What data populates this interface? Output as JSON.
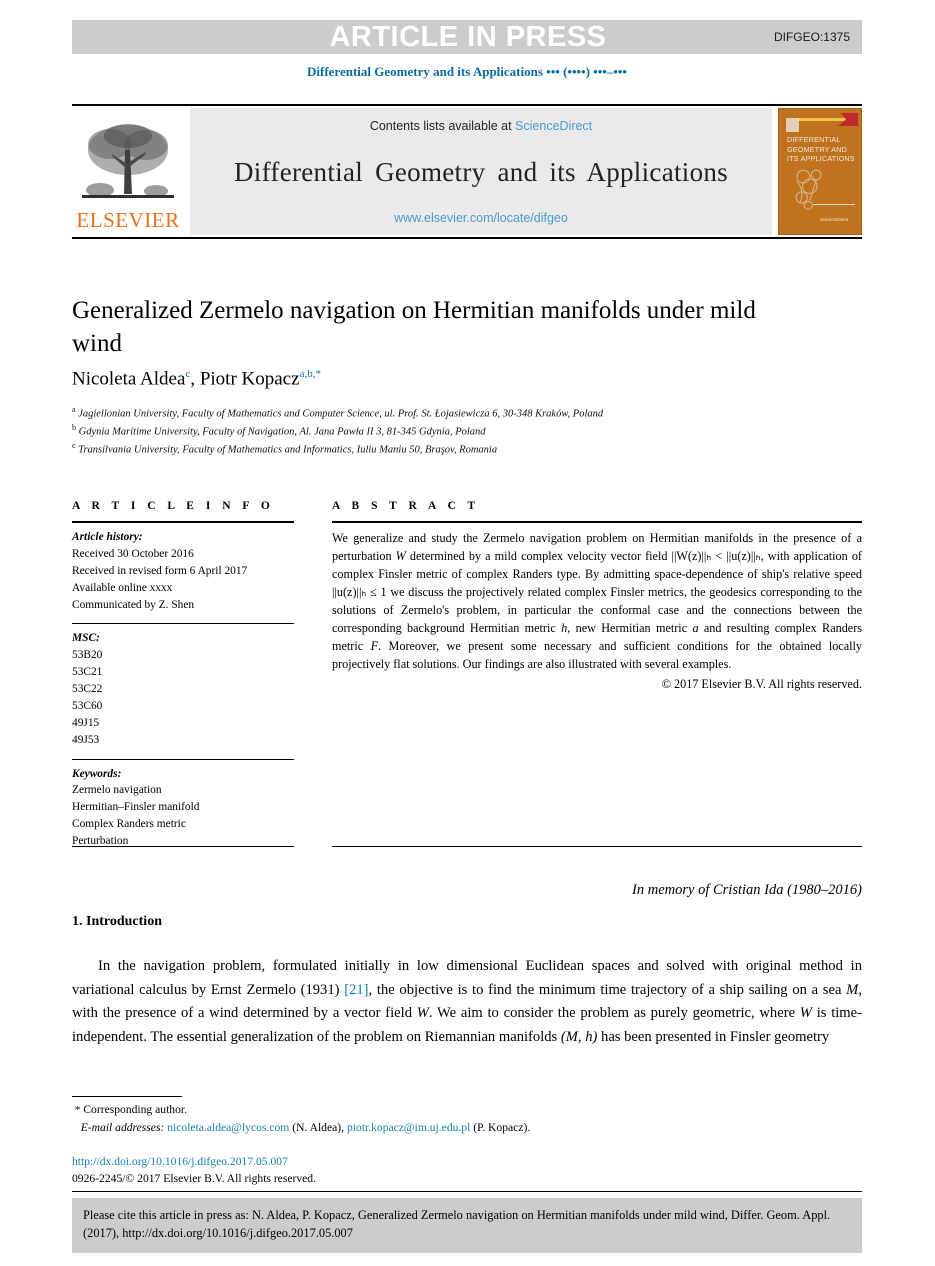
{
  "banner": {
    "press_text": "ARTICLE IN PRESS",
    "code": "DIFGEO:1375",
    "journal_running_head": "Differential Geometry and its Applications ••• (••••) •••–•••",
    "band_color": "#cccccc",
    "press_text_color": "#ffffff",
    "running_head_color": "#0b6ba0"
  },
  "masthead": {
    "publisher_name": "ELSEVIER",
    "publisher_color": "#e8711a",
    "contents_prefix": "Contents lists available at ",
    "contents_link": "ScienceDirect",
    "journal_title": "Differential Geometry and its Applications",
    "journal_url": "www.elsevier.com/locate/difgeo",
    "link_color": "#4a9ad4",
    "cover": {
      "title_lines": "DIFFERENTIAL GEOMETRY AND ITS APPLICATIONS",
      "footer_text": "ScienceDirect",
      "background_color": "#c0721f"
    }
  },
  "article": {
    "title": "Generalized Zermelo navigation on Hermitian manifolds under mild wind",
    "authors_plain": "Nicoleta Aldea, Piotr Kopacz",
    "author_1_name": "Nicoleta Aldea",
    "author_1_sup": "c",
    "author_2_name": "Piotr Kopacz",
    "author_2_sup": "a,b,",
    "author_2_star": "*",
    "affiliations": [
      {
        "mark": "a",
        "text": "Jagiellonian University, Faculty of Mathematics and Computer Science, ul. Prof. St. Łojasiewicza 6, 30-348 Kraków, Poland"
      },
      {
        "mark": "b",
        "text": "Gdynia Maritime University, Faculty of Navigation, Al. Jana Pawła II 3, 81-345 Gdynia, Poland"
      },
      {
        "mark": "c",
        "text": "Transilvania University, Faculty of Mathematics and Informatics, Iuliu Maniu 50, Braşov, Romania"
      }
    ]
  },
  "info": {
    "heading": "A R T I C L E   I N F O",
    "history_label": "Article history:",
    "history_lines": [
      "Received 30 October 2016",
      "Received in revised form 6 April 2017",
      "Available online xxxx",
      "Communicated by Z. Shen"
    ],
    "msc_label": "MSC:",
    "msc_codes": [
      "53B20",
      "53C21",
      "53C22",
      "53C60",
      "49J15",
      "49J53"
    ],
    "keywords_label": "Keywords:",
    "keywords": [
      "Zermelo navigation",
      "Hermitian–Finsler manifold",
      "Complex Randers metric",
      "Perturbation"
    ]
  },
  "abstract": {
    "heading": "A B S T R A C T",
    "paragraph_part_1": "We generalize and study the Zermelo navigation problem on Hermitian manifolds in the presence of a perturbation ",
    "w_symbol": "W",
    "paragraph_part_2": " determined by a mild complex velocity vector field ||W(z)||ₕ < ||u(z)||ₕ, with application of complex Finsler metric of complex Randers type. By admitting space-dependence of ship's relative speed ||u(z)||ₕ ≤ 1 we discuss the projectively related complex Finsler metrics, the geodesics corresponding to the solutions of Zermelo's problem, in particular the conformal case and the connections between the corresponding background Hermitian metric ",
    "h_symbol": "h",
    "paragraph_part_3": ", new Hermitian metric ",
    "a_symbol": "a",
    "paragraph_part_4": " and resulting complex Randers metric ",
    "f_symbol": "F",
    "paragraph_part_5": ". Moreover, we present some necessary and sufficient conditions for the obtained locally projectively flat solutions. Our findings are also illustrated with several examples.",
    "copyright": "© 2017 Elsevier B.V. All rights reserved."
  },
  "memorial": "In memory of Cristian Ida (1980–2016)",
  "introduction": {
    "section_number_title": "1. Introduction",
    "paragraph_1": "In the navigation problem, formulated initially in low dimensional Euclidean spaces and solved with original method in variational calculus by Ernst Zermelo (1931) ",
    "reference_link": "[21]",
    "paragraph_2": ", the objective is to find the minimum time trajectory of a ship sailing on a sea ",
    "m_symbol": "M",
    "paragraph_3": ", with the presence of a wind determined by a vector field ",
    "w_symbol": "W",
    "paragraph_4": ". We aim to consider the problem as purely geometric, where ",
    "w_symbol_2": "W",
    "paragraph_5": " is time-independent. The essential generalization of the problem on Riemannian manifolds ",
    "mh_symbol": "(M, h)",
    "paragraph_6": " has been presented in Finsler geometry"
  },
  "footnotes": {
    "star": "*",
    "corresponding": "Corresponding author.",
    "email_label": "E-mail addresses:",
    "email_1": "nicoleta.aldea@lycos.com",
    "email_1_owner": "(N. Aldea),",
    "email_2": "piotr.kopacz@im.uj.edu.pl",
    "email_2_owner": "(P. Kopacz).",
    "doi_url": "http://dx.doi.org/10.1016/j.difgeo.2017.05.007",
    "issn_line": "0926-2245/© 2017 Elsevier B.V. All rights reserved.",
    "link_color": "#1a7fb5"
  },
  "citation_box": {
    "text": "Please cite this article in press as: N. Aldea, P. Kopacz, Generalized Zermelo navigation on Hermitian manifolds under mild wind, Differ. Geom. Appl. (2017), http://dx.doi.org/10.1016/j.difgeo.2017.05.007",
    "background_color": "#cccccc"
  }
}
